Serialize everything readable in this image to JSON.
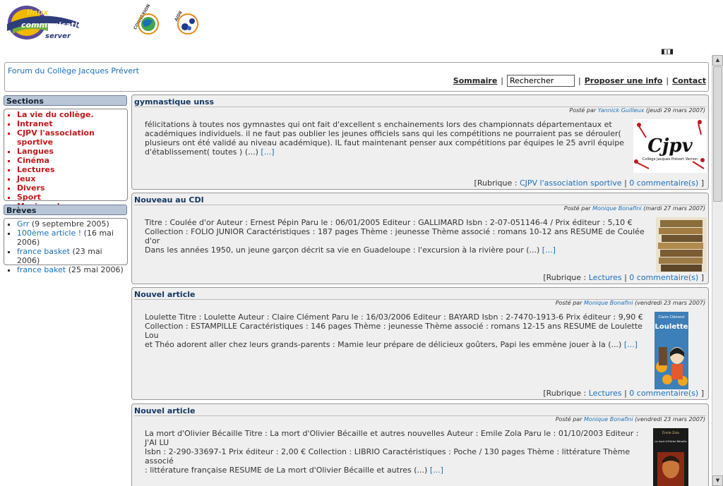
{
  "logo": {
    "line1": "linux",
    "line2": "communication",
    "line3": "server"
  },
  "top_icons": [
    {
      "caption": "CONNEXION",
      "icon": "globe-icon"
    },
    {
      "caption": "AIDE",
      "icon": "help-molecule-icon"
    }
  ],
  "header": {
    "site_title": "Forum du Collège Jacques Prévert",
    "nav": {
      "sommaire": "Sommaire",
      "search_value": "Rechercher",
      "proposer": "Proposer une info",
      "contact": "Contact"
    }
  },
  "sidebar": {
    "sections_title": "Sections",
    "sections": [
      "La vie du collège.",
      "Intranet",
      "CJPV l'association sportive",
      "Langues",
      "Cinéma",
      "Lectures",
      "Jeux",
      "Divers",
      "Sport",
      "Musique !"
    ],
    "breves_title": "Brèves",
    "breves": [
      {
        "label": "Grr",
        "date": "(9 septembre 2005)"
      },
      {
        "label": "100ème article !",
        "date": "(16 mai 2006)"
      },
      {
        "label": "france basket",
        "date": "(23 mai 2006)"
      },
      {
        "label": "france baket",
        "date": "(25 mai 2006)"
      }
    ]
  },
  "articles": [
    {
      "title": "gymnastique unss",
      "posted_prefix": "Posté par",
      "author": "Yannick Guilleux",
      "date": "(jeudi 29 mars 2007)",
      "lines": [
        "félicitations à toutes nos gymnastes qui ont fait d'excellent s enchainements lors des championnats départementaux et",
        "académiques individuels. il ne faut pas oublier les jeunes officiels sans qui les compétitions ne pourraient pas se dérouler(",
        "plusieurs ont été validé au niveau académique). IL faut maintenant penser aux compétitions par équipes le 25 avril équipe",
        "d'établissement( toutes ) (...)"
      ],
      "more": "[...]",
      "rubrique_prefix": "[Rubrique :",
      "rubrique": "CJPV l'association sportive",
      "comments": "0 commentaire(s)",
      "image": {
        "logo_text": "Cjpv",
        "caption": "Collège Jacques Prévert Vernon"
      }
    },
    {
      "title": "Nouveau au CDI",
      "posted_prefix": "Posté par",
      "author": "Monique Bonafini",
      "date": "(mardi 27 mars 2007)",
      "lines": [
        "Titre : Coulée d'or Auteur : Ernest Pépin Paru le : 06/01/2005 Editeur : GALLIMARD Isbn : 2-07-051146-4 / Prix éditeur : 5,10 €",
        "Collection : FOLIO JUNIOR Caractéristiques : 187 pages Thème : jeunesse Thème associé : romans 10-12 ans RESUME de Coulée d'or",
        "Dans les années 1950, un jeune garçon décrit sa vie en Guadeloupe : l'excursion à la rivière pour (...)"
      ],
      "more": "[...]",
      "rubrique_prefix": "[Rubrique :",
      "rubrique": "Lectures",
      "comments": "0 commentaire(s)"
    },
    {
      "title": "Nouvel article",
      "posted_prefix": "Posté par",
      "author": "Monique Bonafini",
      "date": "(vendredi 23 mars 2007)",
      "lines": [
        "Loulette Titre : Loulette Auteur : Claire Clément Paru le : 16/03/2006 Editeur : BAYARD Isbn : 2-7470-1913-6 Prix éditeur : 9,90 €",
        "Collection : ESTAMPILLE Caractéristiques : 146 pages Thème : jeunesse Thème associé : romans 12-15 ans RESUME de Loulette Lou",
        "et Théo adorent aller chez leurs grands-parents : Mamie leur prépare de délicieux goûters, Papi les emmène jouer à la (...)"
      ],
      "more": "[...]",
      "rubrique_prefix": "[Rubrique :",
      "rubrique": "Lectures",
      "comments": "0 commentaire(s)",
      "image": {
        "author": "Claire Clément",
        "book_title": "Loulette"
      }
    },
    {
      "title": "Nouvel article",
      "posted_prefix": "Posté par",
      "author": "Monique Bonafini",
      "date": "(vendredi 23 mars 2007)",
      "lines": [
        "La mort d'Olivier Bécaille Titre : La mort d'Olivier Bécaille et autres nouvelles Auteur : Emile Zola Paru le : 01/10/2003 Editeur : J'AI LU",
        "Isbn : 2-290-33697-1 Prix éditeur : 2,00 € Collection : LIBRIO Caractéristiques : Poche / 130 pages Thème : littérature Thème associé",
        ": littérature française RESUME de La mort d'Olivier Bécaille et autres (...)"
      ],
      "more": "[...]",
      "image": {
        "author": "Émile Zola",
        "book_title": "La mort d'Olivier Bécaille"
      }
    }
  ],
  "colors": {
    "link": "#1c6fb8",
    "section_red": "#c0191b",
    "title_navy": "#13365f",
    "side_head_bg": "#b9c6d7",
    "article_bg": "#efefef"
  }
}
